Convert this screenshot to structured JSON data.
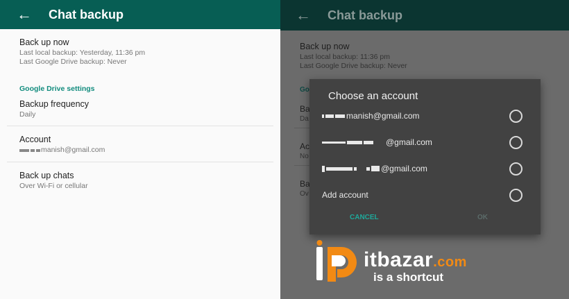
{
  "left": {
    "appbar": {
      "title": "Chat backup"
    },
    "backup_now": {
      "title": "Back up now",
      "local": "Last local backup: Yesterday, 11:36 pm",
      "drive": "Last Google Drive backup: Never"
    },
    "section": "Google Drive settings",
    "frequency": {
      "title": "Backup frequency",
      "value": "Daily"
    },
    "account": {
      "title": "Account",
      "value": "manish@gmail.com"
    },
    "chats": {
      "title": "Back up chats",
      "value": "Over Wi-Fi or cellular"
    }
  },
  "right": {
    "appbar": {
      "title": "Chat backup"
    },
    "backup_now": {
      "title": "Back up now",
      "local": "Last local backup: 11:36 pm",
      "drive": "Last Google Drive backup: Never"
    },
    "dialog": {
      "title": "Choose an account",
      "accounts": [
        {
          "label": "manish@gmail.com",
          "selected": false
        },
        {
          "label": "@gmail.com",
          "selected": false
        },
        {
          "label": "@gmail.com",
          "selected": false
        },
        {
          "label": "Add account",
          "selected": false
        }
      ],
      "cancel": "CANCEL",
      "ok": "OK"
    }
  },
  "logo": {
    "word": "itbazar",
    "tld": ".com",
    "tagline": "is a shortcut",
    "accent": "#f28a14"
  },
  "icons": {
    "back": "arrow-left-icon"
  },
  "colors": {
    "appbar": "#075e54",
    "section": "#128c7e",
    "dialog_bg": "#424242",
    "cancel": "#1fa89a"
  }
}
